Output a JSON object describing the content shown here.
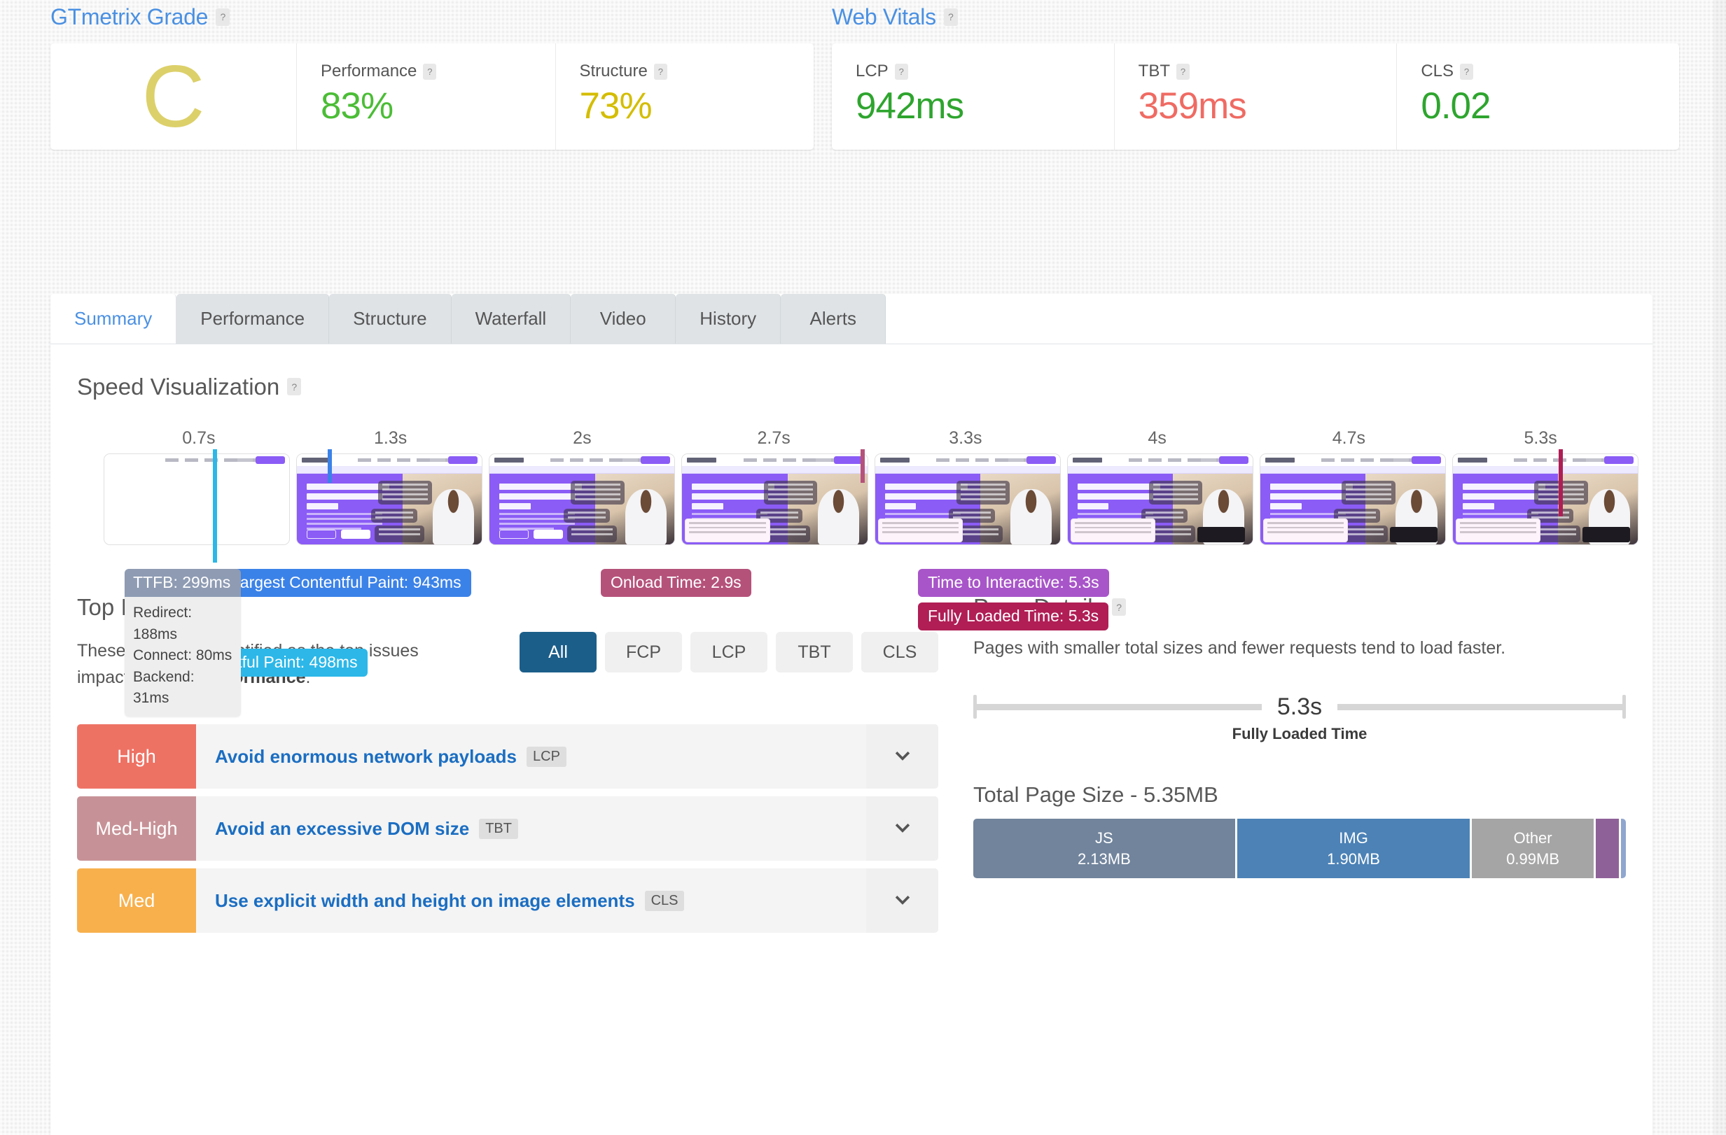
{
  "gtmetrix_grade": {
    "title": "GTmetrix Grade",
    "help": "?",
    "grade": "C",
    "grade_color": "#dcd06a",
    "metrics": [
      {
        "label": "Performance",
        "value": "83%",
        "color": "#4bbd36"
      },
      {
        "label": "Structure",
        "value": "73%",
        "color": "#d4bd00"
      }
    ]
  },
  "web_vitals": {
    "title": "Web Vitals",
    "help": "?",
    "metrics": [
      {
        "label": "LCP",
        "value": "942ms",
        "color": "#2ea52e"
      },
      {
        "label": "TBT",
        "value": "359ms",
        "color": "#ef6b63"
      },
      {
        "label": "CLS",
        "value": "0.02",
        "color": "#2ea52e"
      }
    ]
  },
  "tabs": [
    {
      "label": "Summary",
      "active": true
    },
    {
      "label": "Performance",
      "active": false
    },
    {
      "label": "Structure",
      "active": false
    },
    {
      "label": "Waterfall",
      "active": false
    },
    {
      "label": "Video",
      "active": false
    },
    {
      "label": "History",
      "active": false
    },
    {
      "label": "Alerts",
      "active": false
    }
  ],
  "speed_visualization": {
    "title": "Speed Visualization",
    "help": "?",
    "ticks": [
      "0.7s",
      "1.3s",
      "2s",
      "2.7s",
      "3.3s",
      "4s",
      "4.7s",
      "5.3s"
    ],
    "markers": [
      {
        "name": "first-contentful-paint",
        "label": "First Contentful Paint: 498ms",
        "color": "#2cb7e8",
        "left_pct": 7.1,
        "label_top": 148,
        "label_left": 52
      },
      {
        "name": "largest-contentful-paint",
        "label": "Largest Contentful Paint: 943ms",
        "color": "#3b82e8",
        "left_pct": 14.6,
        "label_top": 34,
        "label_left": 168
      },
      {
        "name": "onload-time",
        "label": "Onload Time: 2.9s",
        "color": "#b5527a",
        "left_pct": 49.3,
        "label_top": 34,
        "label_left": 710
      },
      {
        "name": "time-to-interactive",
        "label": "Time to Interactive: 5.3s",
        "color": "#a855c9",
        "left_pct": 94.8,
        "label_top": 34,
        "label_left": 1163
      },
      {
        "name": "fully-loaded-time",
        "label": "Fully Loaded Time: 5.3s",
        "color": "#b01e55",
        "left_pct": 94.8,
        "label_top": 82,
        "label_left": 1163
      }
    ],
    "ttfb": {
      "heading": "TTFB: 299ms",
      "rows": [
        "Redirect: 188ms",
        "Connect: 80ms",
        "Backend: 31ms"
      ]
    }
  },
  "top_issues": {
    "title": "Top Issues",
    "description_1": "These audits are identified as the top issues impacting",
    "description_2": "your performance",
    "description_3": ".",
    "filters": [
      {
        "label": "All",
        "active": true
      },
      {
        "label": "FCP",
        "active": false
      },
      {
        "label": "LCP",
        "active": false
      },
      {
        "label": "TBT",
        "active": false
      },
      {
        "label": "CLS",
        "active": false
      }
    ],
    "issues": [
      {
        "severity": "High",
        "severity_color": "#ee7264",
        "title": "Avoid enormous network payloads",
        "tag": "LCP",
        "expand_icon": "chevron-down-icon"
      },
      {
        "severity": "Med-High",
        "severity_color": "#c79297",
        "title": "Avoid an excessive DOM size",
        "tag": "TBT",
        "expand_icon": "chevron-down-icon"
      },
      {
        "severity": "Med",
        "severity_color": "#f8b04c",
        "title": "Use explicit width and height on image elements",
        "tag": "CLS",
        "expand_icon": "chevron-down-icon"
      }
    ]
  },
  "page_details": {
    "title": "Page Details",
    "help": "?",
    "description": "Pages with smaller total sizes and fewer requests tend to load faster.",
    "fully_loaded_value": "5.3s",
    "fully_loaded_label": "Fully Loaded Time",
    "total_size_title": "Total Page Size - 5.35MB",
    "segments": [
      {
        "label": "JS",
        "size": "2.13MB",
        "color": "#71849c",
        "pct": 40.1
      },
      {
        "label": "IMG",
        "size": "1.90MB",
        "color": "#4c82b6",
        "pct": 35.7
      },
      {
        "label": "Other",
        "size": "0.99MB",
        "color": "#a5a5a5",
        "pct": 18.6
      },
      {
        "label": "",
        "size": "",
        "color": "#8f6199",
        "pct": 3.6
      },
      {
        "label": "",
        "size": "",
        "color": "#8fa6cf",
        "pct": 0.8
      },
      {
        "label": "",
        "size": "",
        "color": "#dfa3c2",
        "pct": 1.2
      }
    ]
  }
}
